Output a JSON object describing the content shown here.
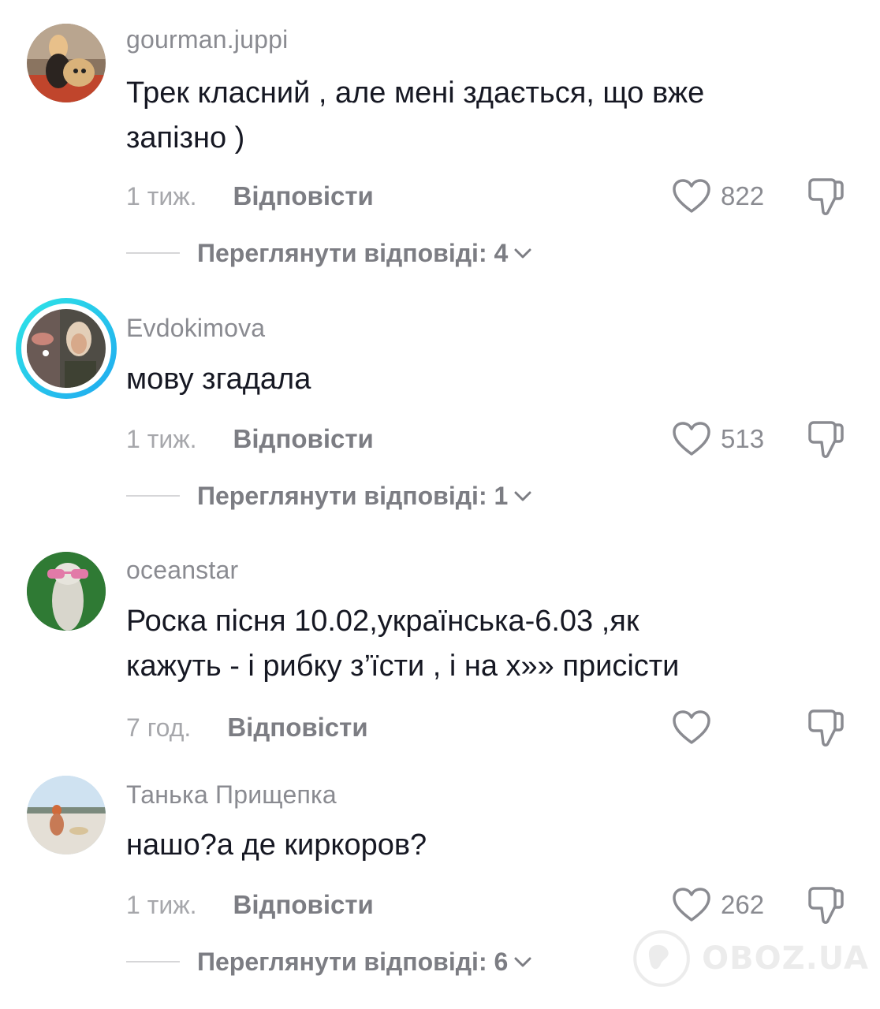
{
  "comments": [
    {
      "username": "gourman.juppi",
      "text": "Трек класний , але мені здається, що вже\nзапізно )",
      "time": "1 тиж.",
      "reply_label": "Відповісти",
      "likes": "822",
      "view_replies": "Переглянути відповіді: 4"
    },
    {
      "username": "Evdokimova",
      "text": "мову згадала",
      "time": "1 тиж.",
      "reply_label": "Відповісти",
      "likes": "513",
      "view_replies": "Переглянути відповіді: 1"
    },
    {
      "username": "oceanstar",
      "text": "Роска пісня 10.02,українська-6.03 ,як\nкажуть - і рибку з’їсти , і на х»»  присісти",
      "time": "7 год.",
      "reply_label": "Відповісти",
      "likes": "",
      "view_replies": ""
    },
    {
      "username": "Танька Прищепка",
      "text": "нашо?а де киркоров?",
      "time": "1 тиж.",
      "reply_label": "Відповісти",
      "likes": "262",
      "view_replies": "Переглянути відповіді: 6"
    }
  ],
  "icons": {
    "like": "heart-outline-icon",
    "dislike": "thumbs-down-icon",
    "expand": "chevron-down-icon"
  },
  "watermark": "OBOZ.UA"
}
